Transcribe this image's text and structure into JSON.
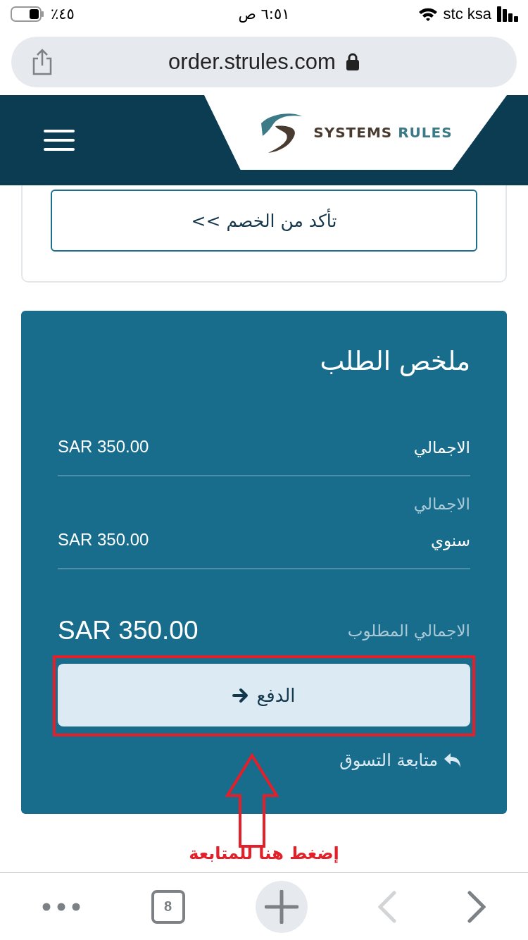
{
  "status_bar": {
    "battery": "٪٤٥",
    "time": "٦:٥١ ص",
    "carrier": "stc ksa"
  },
  "address_bar": {
    "url": "order.strules.com"
  },
  "header": {
    "logo_text": "SYSTEMS RULES"
  },
  "discount_button": "تأكد من الخصم >>",
  "summary": {
    "title": "ملخص الطلب",
    "rows": [
      {
        "label": "الاجمالي",
        "value": "SAR 350.00"
      },
      {
        "caption": "الاجمالي",
        "label": "سنوي",
        "value": "SAR 350.00"
      }
    ],
    "total_label": "الاجمالي المطلوب",
    "total_value": "SAR 350.00",
    "pay_button": "الدفع",
    "continue_link": "متابعة التسوق"
  },
  "annotation": {
    "text": "إضغط هنا للمتابعة"
  },
  "toolbar": {
    "tab_count": "8",
    "back_disabled": true,
    "forward_disabled": false
  }
}
